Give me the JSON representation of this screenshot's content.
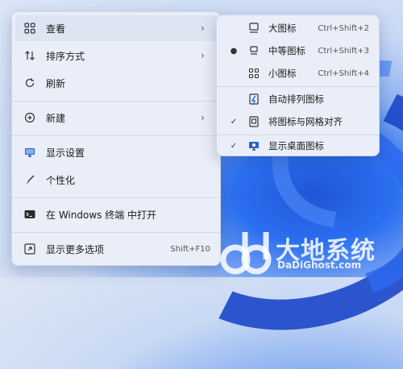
{
  "main_menu": {
    "items": [
      {
        "label": "查看",
        "icon": "grid-icon",
        "submenu": true
      },
      {
        "label": "排序方式",
        "icon": "sort-icon",
        "submenu": true
      },
      {
        "label": "刷新",
        "icon": "refresh-icon"
      },
      {
        "label": "新建",
        "icon": "add-circle-icon",
        "submenu": true
      },
      {
        "label": "显示设置",
        "icon": "display-icon"
      },
      {
        "label": "个性化",
        "icon": "brush-icon"
      },
      {
        "label": "在 Windows 终端 中打开",
        "icon": "terminal-icon"
      },
      {
        "label": "显示更多选项",
        "icon": "more-options-icon",
        "shortcut": "Shift+F10"
      }
    ]
  },
  "view_submenu": {
    "items": [
      {
        "label": "大图标",
        "icon": "large-icons-icon",
        "shortcut": "Ctrl+Shift+2",
        "selected": false
      },
      {
        "label": "中等图标",
        "icon": "medium-icons-icon",
        "shortcut": "Ctrl+Shift+3",
        "selected": true
      },
      {
        "label": "小图标",
        "icon": "small-icons-icon",
        "shortcut": "Ctrl+Shift+4",
        "selected": false
      },
      {
        "label": "自动排列图标",
        "icon": "auto-arrange-icon",
        "checked": false
      },
      {
        "label": "将图标与网格对齐",
        "icon": "align-grid-icon",
        "checked": true
      },
      {
        "label": "显示桌面图标",
        "icon": "show-desktop-icon",
        "checked": true
      }
    ]
  },
  "watermark": {
    "text": "大地系统",
    "sub": "DaDiGhost.com"
  },
  "colors": {
    "menu_bg": "#e9eef8",
    "hover": "#dde5f3",
    "accent": "#1c47c9"
  }
}
